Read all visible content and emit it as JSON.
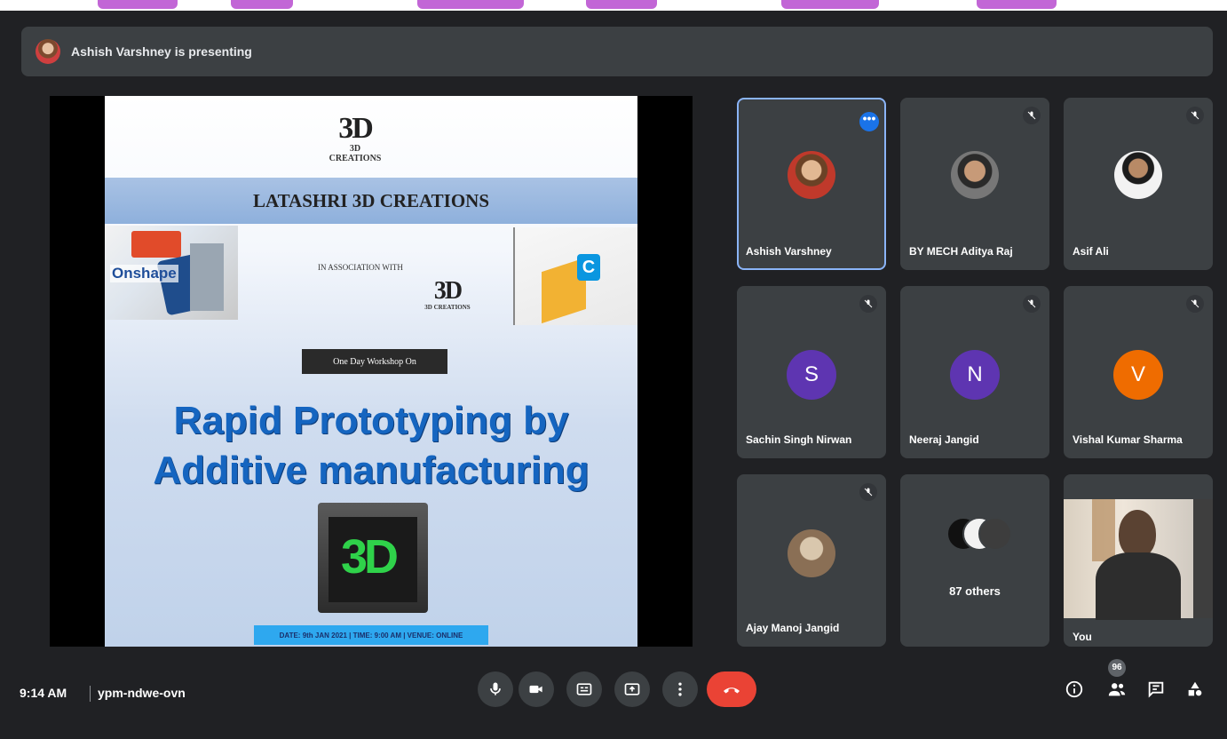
{
  "presenter_bar": {
    "text": "Ashish Varshney is presenting"
  },
  "slide": {
    "logo_text": "3D CREATIONS",
    "logo_mark": "3D",
    "banner_title": "LATASHRI 3D CREATIONS",
    "onshape_label": "Onshape",
    "association_text": "IN ASSOCIATION WITH",
    "creo_logo": "C",
    "workshop_label": "One Day Workshop On",
    "headline_line1": "Rapid Prototyping by",
    "headline_line2": "Additive manufacturing",
    "printer_text": "3D",
    "footer_text": "DATE: 9th JAN 2021 | TIME: 9:00 AM | VENUE: ONLINE"
  },
  "participants": [
    {
      "name": "Ashish Varshney",
      "avatar": "photo",
      "active": true,
      "indicator": "more-options"
    },
    {
      "name": "BY MECH Aditya Raj",
      "avatar": "photo",
      "indicator": "mic-off"
    },
    {
      "name": "Asif Ali",
      "avatar": "photo",
      "indicator": "mic-off"
    },
    {
      "name": "Sachin Singh Nirwan",
      "avatar_letter": "S",
      "avatar_color": "#5e35b1",
      "indicator": "mic-off"
    },
    {
      "name": "Neeraj Jangid",
      "avatar_letter": "N",
      "avatar_color": "#5e35b1",
      "indicator": "mic-off"
    },
    {
      "name": "Vishal Kumar Sharma",
      "avatar_letter": "V",
      "avatar_color": "#ef6c00",
      "indicator": "mic-off"
    },
    {
      "name": "Ajay Manoj Jangid",
      "avatar": "photo",
      "indicator": "mic-off"
    },
    {
      "others_label": "87 others"
    },
    {
      "name": "You",
      "avatar": "video"
    }
  ],
  "bottom_bar": {
    "time": "9:14 AM",
    "meeting_code": "ypm-ndwe-ovn",
    "participant_count": "96"
  },
  "colors": {
    "background": "#202124",
    "tile": "#3c4043",
    "end_call": "#ea4335",
    "accent": "#8ab4f8"
  }
}
